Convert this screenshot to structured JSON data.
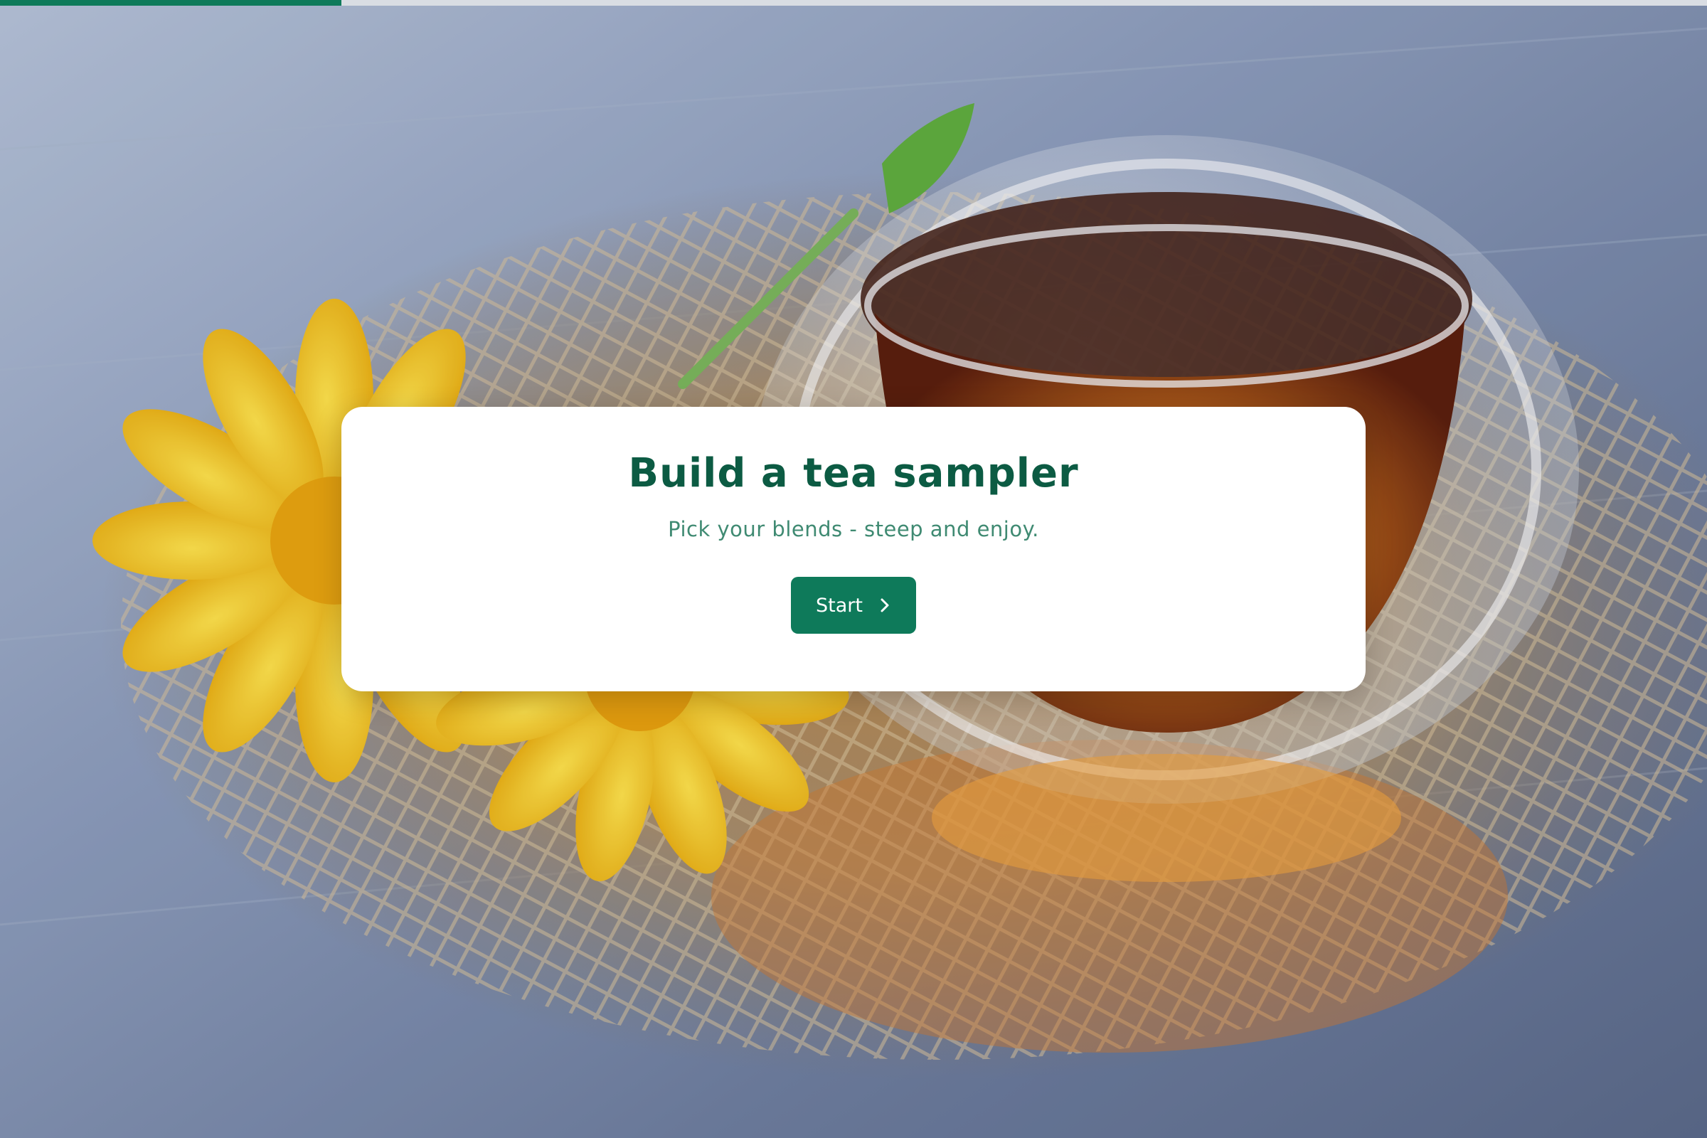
{
  "progress": {
    "fraction": 0.2
  },
  "intro": {
    "title": "Build a tea sampler",
    "subtitle": "Pick your blends - steep and enjoy.",
    "start_label": "Start",
    "start_icon": "chevron-right-icon"
  },
  "theme": {
    "accent": "#0e7a5a",
    "title_color": "#0c5b43",
    "subtitle_color": "#3f8a72",
    "progress_track": "#d9dde3"
  },
  "background": {
    "subject": "glass cup of amber tea on burlap with yellow calendula flowers and green leaf on blue wooden table"
  }
}
